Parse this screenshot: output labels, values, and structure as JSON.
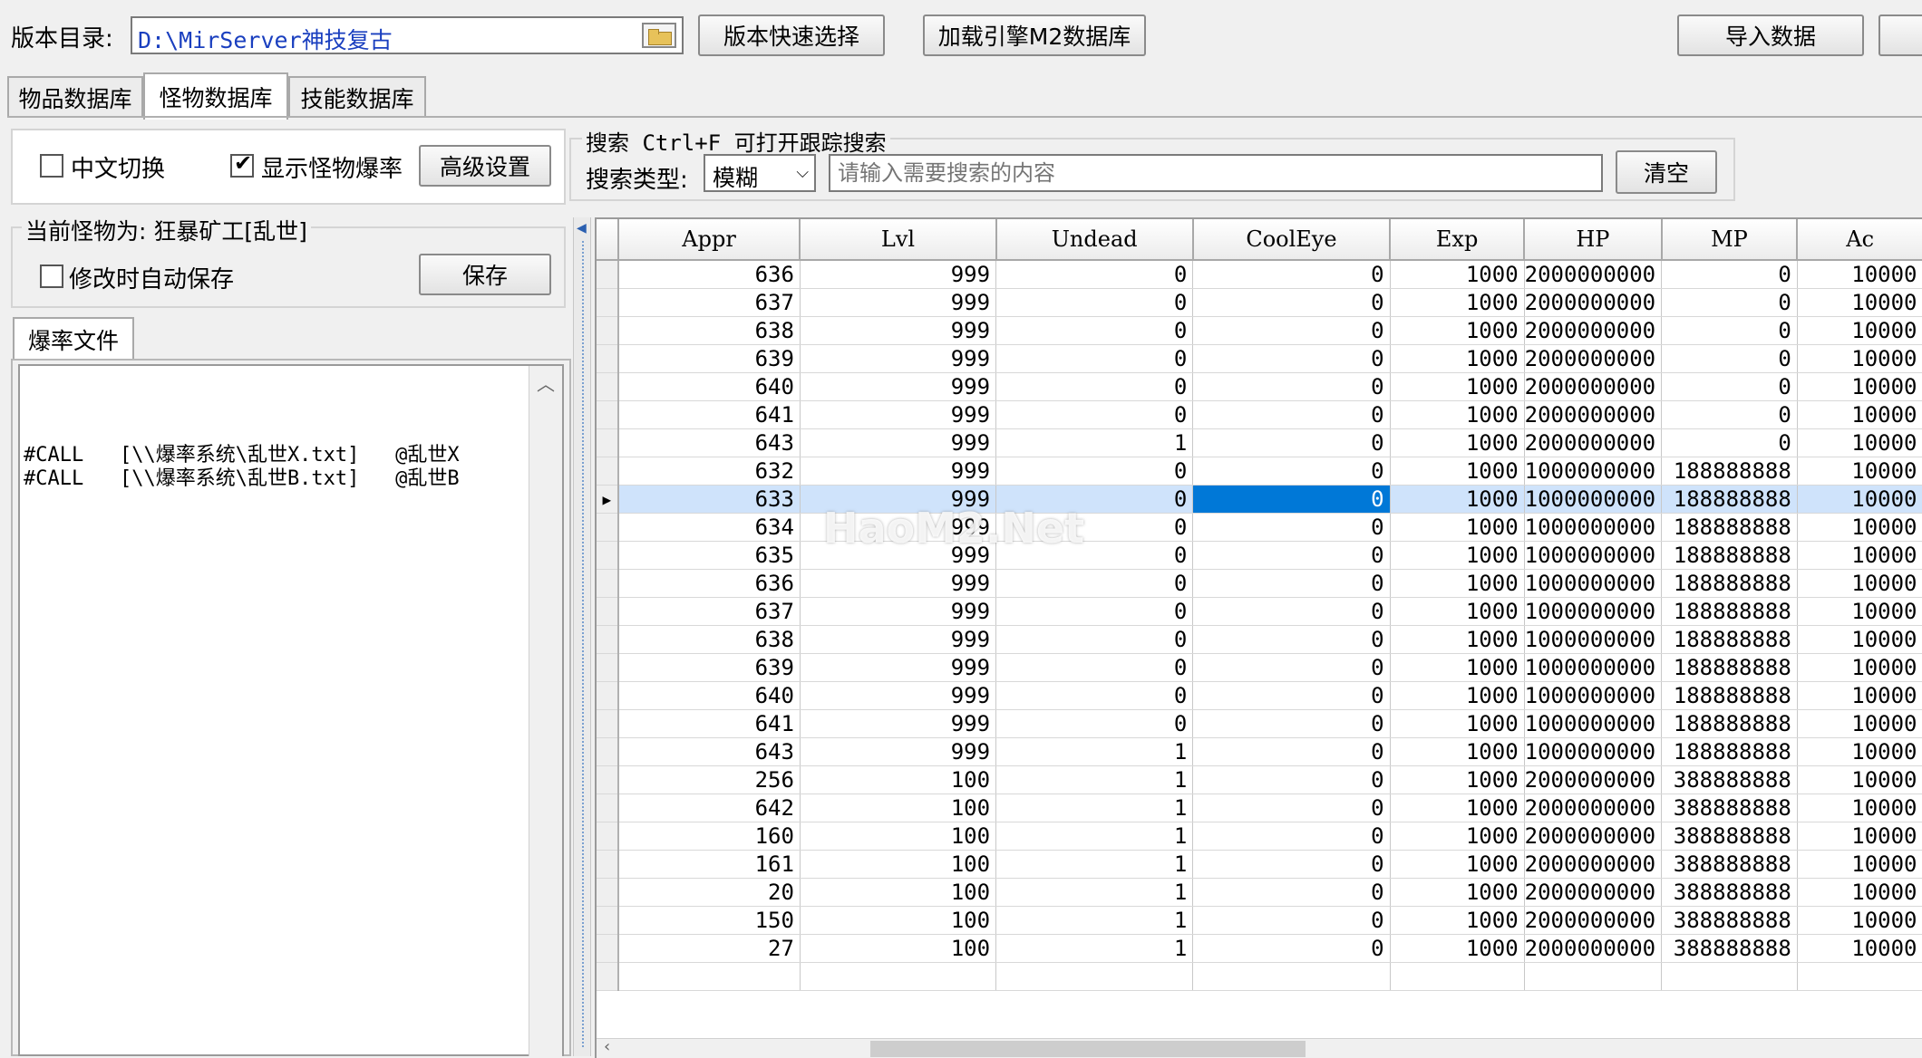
{
  "toolbar": {
    "version_dir_label": "版本目录:",
    "version_dir_value": "D:\\MirServer神技复古",
    "quick_select_label": "版本快速选择",
    "load_engine_label": "加载引擎M2数据库",
    "import_label": "导入数据"
  },
  "tabs": [
    {
      "label": "物品数据库"
    },
    {
      "label": "怪物数据库"
    },
    {
      "label": "技能数据库"
    }
  ],
  "options": {
    "chinese_switch_label": "中文切换",
    "chinese_switch_checked": false,
    "show_droprate_label": "显示怪物爆率",
    "show_droprate_checked": true,
    "advanced_label": "高级设置"
  },
  "search": {
    "title": "搜索  Ctrl+F 可打开跟踪搜索",
    "type_label": "搜索类型:",
    "type_value": "模糊",
    "placeholder": "请输入需要搜索的内容",
    "clear_label": "清空"
  },
  "monster": {
    "current_label": "当前怪物为: 狂暴矿工[乱世]",
    "autosave_label": "修改时自动保存",
    "autosave_checked": false,
    "save_label": "保存"
  },
  "drop_file": {
    "tab_label": "爆率文件",
    "lines": [
      "#CALL   [\\\\爆率系统\\乱世X.txt]   @乱世X",
      "#CALL   [\\\\爆率系统\\乱世B.txt]   @乱世B"
    ]
  },
  "watermark": "HaoM2.Net",
  "grid": {
    "columns": [
      "Appr",
      "Lvl",
      "Undead",
      "CoolEye",
      "Exp",
      "HP",
      "MP",
      "Ac"
    ],
    "selected_row": 8,
    "rows": [
      [
        "636",
        "999",
        "0",
        "0",
        "1000",
        "2000000000",
        "0",
        "10000"
      ],
      [
        "637",
        "999",
        "0",
        "0",
        "1000",
        "2000000000",
        "0",
        "10000"
      ],
      [
        "638",
        "999",
        "0",
        "0",
        "1000",
        "2000000000",
        "0",
        "10000"
      ],
      [
        "639",
        "999",
        "0",
        "0",
        "1000",
        "2000000000",
        "0",
        "10000"
      ],
      [
        "640",
        "999",
        "0",
        "0",
        "1000",
        "2000000000",
        "0",
        "10000"
      ],
      [
        "641",
        "999",
        "0",
        "0",
        "1000",
        "2000000000",
        "0",
        "10000"
      ],
      [
        "643",
        "999",
        "1",
        "0",
        "1000",
        "2000000000",
        "0",
        "10000"
      ],
      [
        "632",
        "999",
        "0",
        "0",
        "1000",
        "1000000000",
        "188888888",
        "10000"
      ],
      [
        "633",
        "999",
        "0",
        "0",
        "1000",
        "1000000000",
        "188888888",
        "10000"
      ],
      [
        "634",
        "999",
        "0",
        "0",
        "1000",
        "1000000000",
        "188888888",
        "10000"
      ],
      [
        "635",
        "999",
        "0",
        "0",
        "1000",
        "1000000000",
        "188888888",
        "10000"
      ],
      [
        "636",
        "999",
        "0",
        "0",
        "1000",
        "1000000000",
        "188888888",
        "10000"
      ],
      [
        "637",
        "999",
        "0",
        "0",
        "1000",
        "1000000000",
        "188888888",
        "10000"
      ],
      [
        "638",
        "999",
        "0",
        "0",
        "1000",
        "1000000000",
        "188888888",
        "10000"
      ],
      [
        "639",
        "999",
        "0",
        "0",
        "1000",
        "1000000000",
        "188888888",
        "10000"
      ],
      [
        "640",
        "999",
        "0",
        "0",
        "1000",
        "1000000000",
        "188888888",
        "10000"
      ],
      [
        "641",
        "999",
        "0",
        "0",
        "1000",
        "1000000000",
        "188888888",
        "10000"
      ],
      [
        "643",
        "999",
        "1",
        "0",
        "1000",
        "1000000000",
        "188888888",
        "10000"
      ],
      [
        "256",
        "100",
        "1",
        "0",
        "1000",
        "2000000000",
        "388888888",
        "10000"
      ],
      [
        "642",
        "100",
        "1",
        "0",
        "1000",
        "2000000000",
        "388888888",
        "10000"
      ],
      [
        "160",
        "100",
        "1",
        "0",
        "1000",
        "2000000000",
        "388888888",
        "10000"
      ],
      [
        "161",
        "100",
        "1",
        "0",
        "1000",
        "2000000000",
        "388888888",
        "10000"
      ],
      [
        "20",
        "100",
        "1",
        "0",
        "1000",
        "2000000000",
        "388888888",
        "10000"
      ],
      [
        "150",
        "100",
        "1",
        "0",
        "1000",
        "2000000000",
        "388888888",
        "10000"
      ],
      [
        "27",
        "100",
        "1",
        "0",
        "1000",
        "2000000000",
        "388888888",
        "10000"
      ]
    ]
  }
}
